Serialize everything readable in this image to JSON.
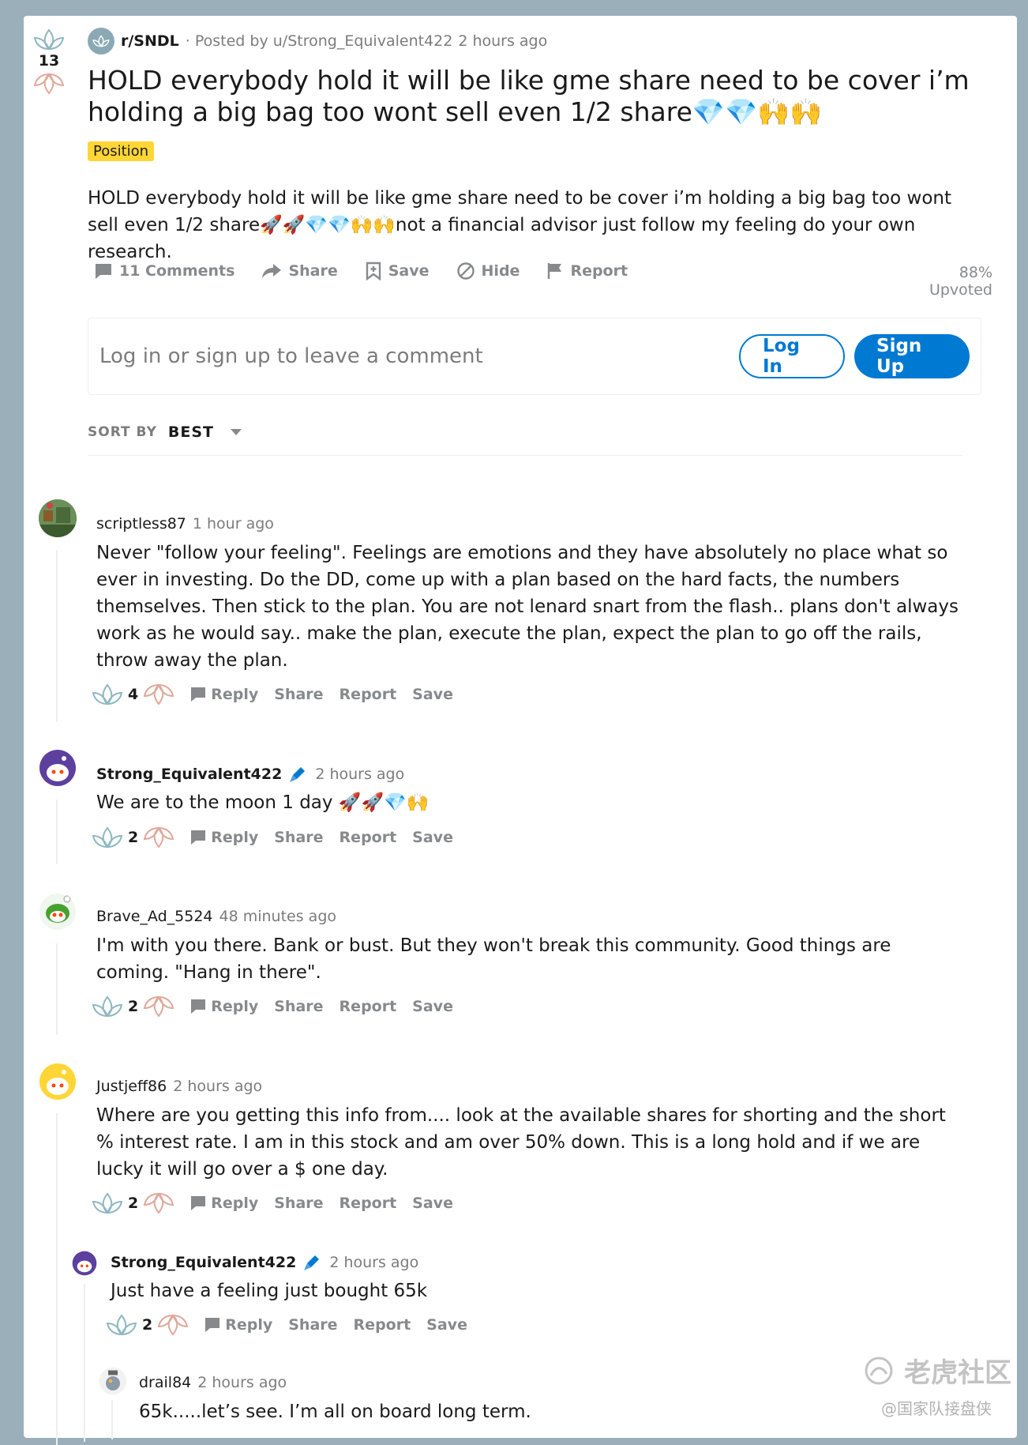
{
  "post": {
    "score": "13",
    "subreddit": "r/SNDL",
    "posted_by": "· Posted by u/Strong_Equivalent422",
    "time": "2 hours ago",
    "title": "HOLD everybody hold it will be like gme share need to be cover i’m holding a big bag too wont sell even 1/2 share💎💎🙌🙌",
    "flair": "Position",
    "body": "HOLD everybody hold it will be like gme share need to be cover i’m holding a big bag too wont sell even 1/2 share🚀🚀💎💎🙌🙌not a financial advisor just follow my feeling do your own research.",
    "actions": {
      "comments": "11 Comments",
      "share": "Share",
      "save": "Save",
      "hide": "Hide",
      "report": "Report"
    },
    "upvoted": "88% Upvoted"
  },
  "comment_box": {
    "prompt": "Log in or sign up to leave a comment",
    "login": "Log In",
    "signup": "Sign Up"
  },
  "sort": {
    "label": "SORT BY",
    "value": "BEST"
  },
  "comment_actions": {
    "reply": "Reply",
    "share": "Share",
    "report": "Report",
    "save": "Save"
  },
  "comments": [
    {
      "author": "scriptless87",
      "time": "1 hour ago",
      "body": "Never \"follow your feeling\". Feelings are emotions and they have absolutely no place what so ever in investing. Do the DD, come up with a plan based on the hard facts, the numbers themselves. Then stick to the plan. You are not lenard snart from the flash.. plans don't always work as he would say.. make the plan, execute the plan, expect the plan to go off the rails, throw away the plan.",
      "score": "4"
    },
    {
      "author": "Strong_Equivalent422",
      "time": "2 hours ago",
      "body": "We are to the moon 1 day 🚀🚀💎🙌",
      "score": "2"
    },
    {
      "author": "Brave_Ad_5524",
      "time": "48 minutes ago",
      "body": "I'm with you there. Bank or bust. But they won't break this community. Good things are coming. \"Hang in there\".",
      "score": "2"
    },
    {
      "author": "Justjeff86",
      "time": "2 hours ago",
      "body": "Where are you getting this info from.... look at the available shares for shorting and the short % interest rate. I am in this stock and am over 50% down. This is a long hold and if we are lucky it will go over a $ one day.",
      "score": "2"
    },
    {
      "author": "Strong_Equivalent422",
      "time": "2 hours ago",
      "body": "Just have a feeling just bought 65k",
      "score": "2"
    },
    {
      "author": "drail84",
      "time": "2 hours ago",
      "body": "65k.....let’s see. I’m all on board long term."
    }
  ],
  "watermark": {
    "main": "老虎社区",
    "sub": "@国家队接盘侠"
  },
  "colors": {
    "background": "#9aafb9",
    "accent": "#0079d3",
    "flair": "#ffd635",
    "upvote": "#8fb8c0",
    "downvote": "#e0a89a"
  }
}
